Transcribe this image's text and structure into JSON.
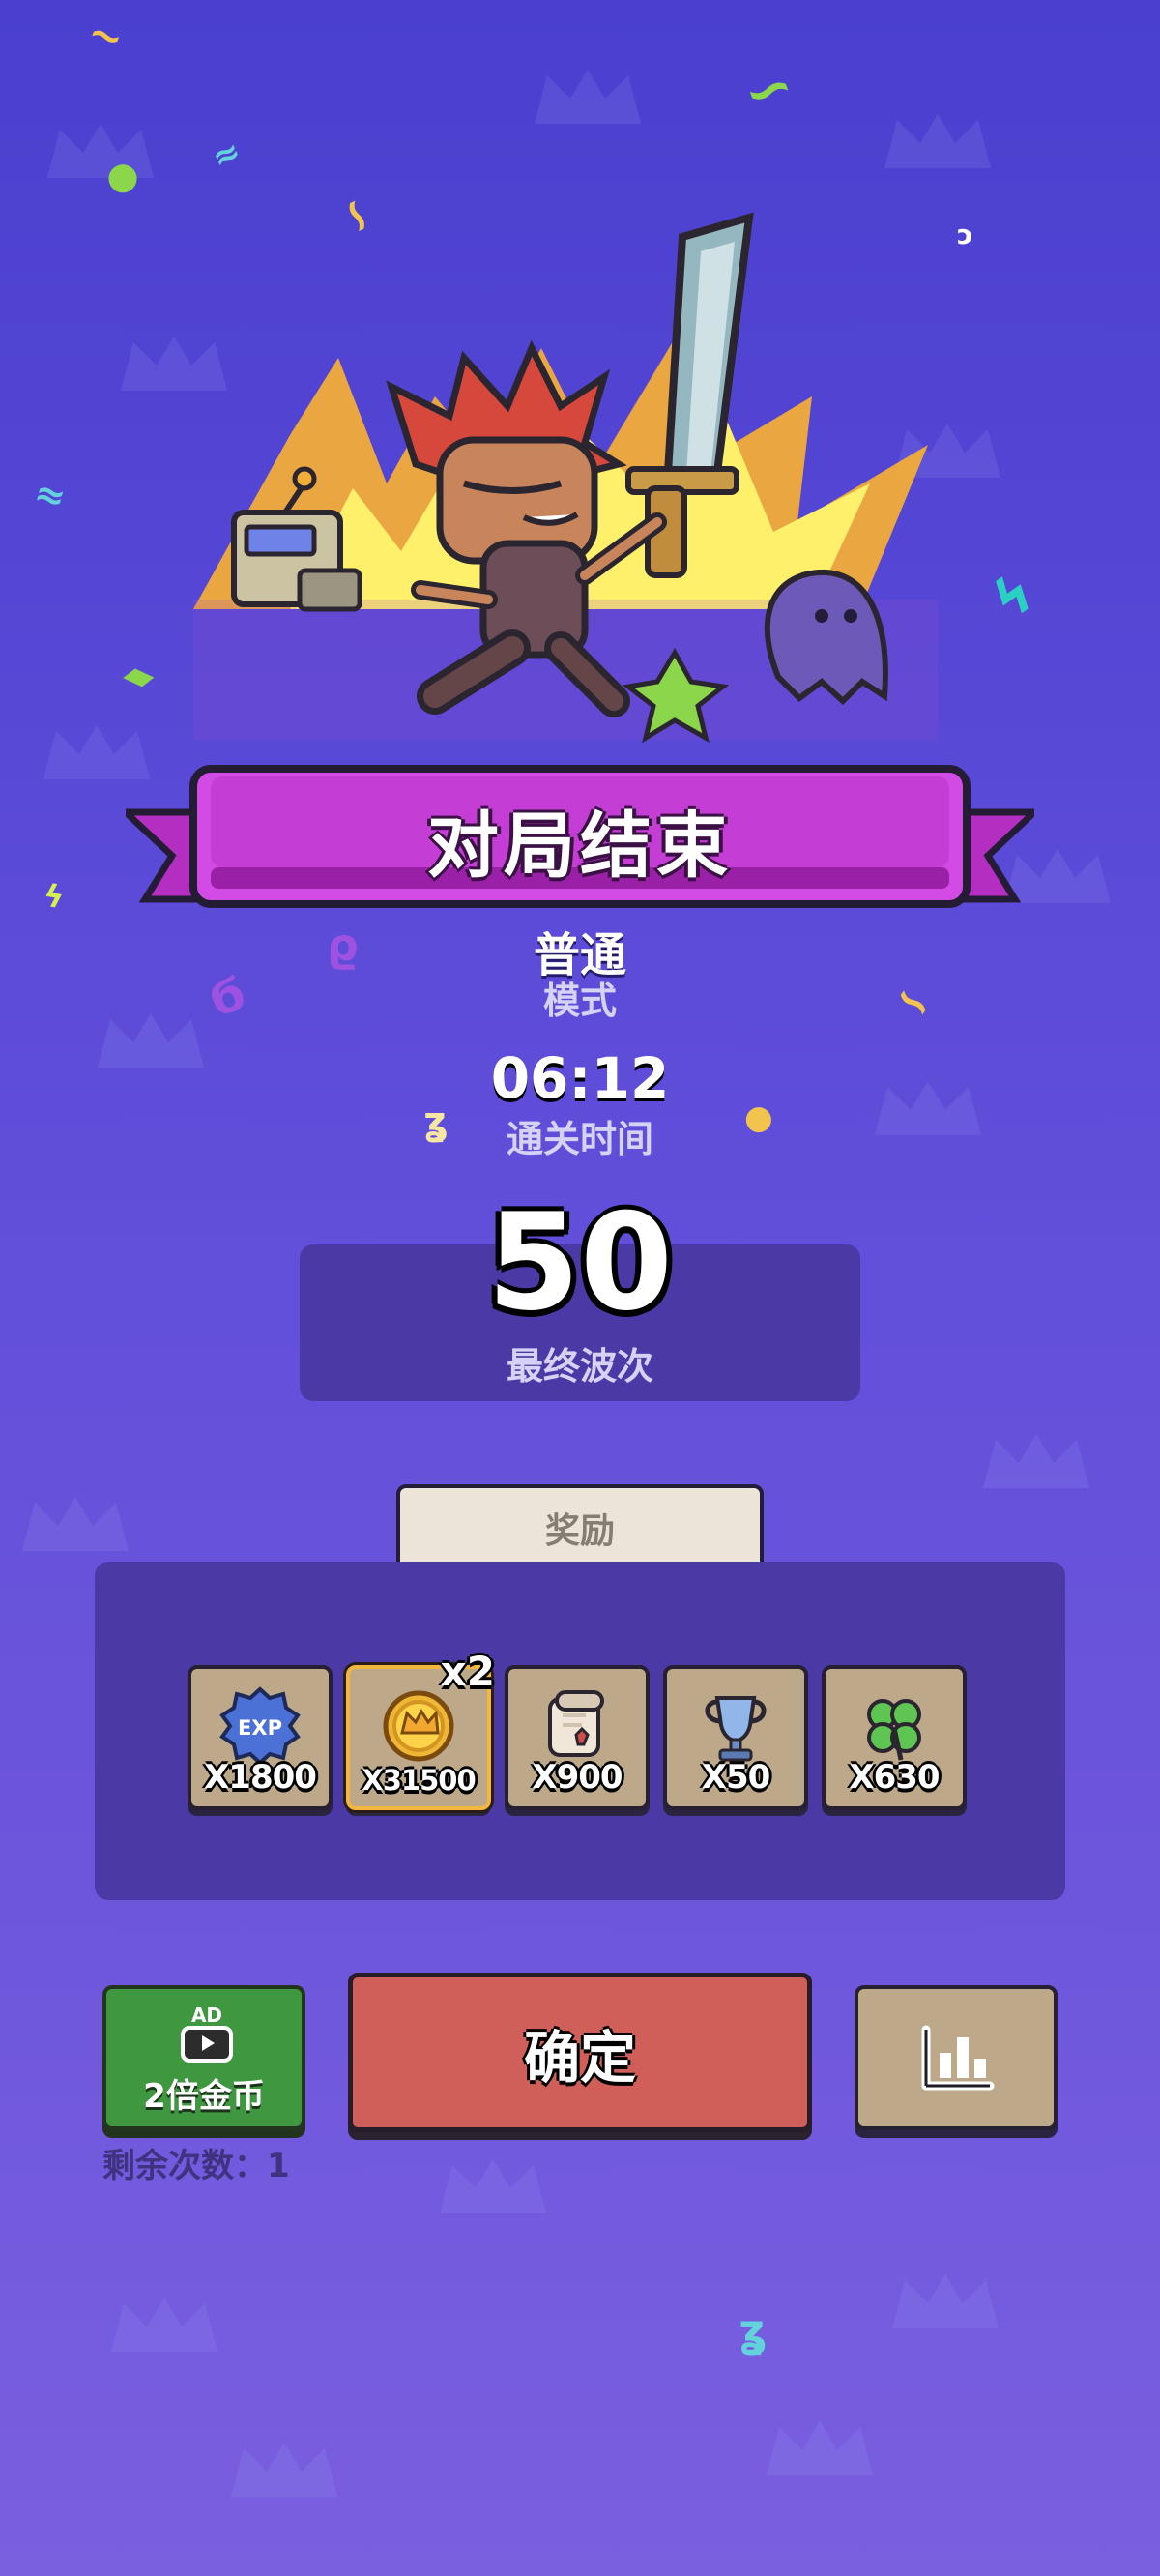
{
  "colors": {
    "background_top": "#4a3fcf",
    "background_bottom": "#7a5fdf",
    "ribbon": "#b531c4",
    "panel": "#4b3aa6",
    "confirm": "#cf5f58",
    "ad_button": "#3f973f",
    "tile": "#bda98a",
    "highlight_border": "#f1b73e"
  },
  "header": {
    "title": "对局结束"
  },
  "summary": {
    "mode_value": "普通",
    "mode_label": "模式",
    "time_value": "06:12",
    "time_label": "通关时间",
    "wave_value": "50",
    "wave_label": "最终波次"
  },
  "rewards": {
    "tab_label": "奖励",
    "items": [
      {
        "icon": "exp-icon",
        "icon_text": "EXP",
        "amount": "X1800"
      },
      {
        "icon": "gold-coin-icon",
        "amount": "X31500",
        "multiplier": "x2"
      },
      {
        "icon": "scroll-icon",
        "amount": "X900"
      },
      {
        "icon": "trophy-icon",
        "amount": "X50"
      },
      {
        "icon": "clover-icon",
        "amount": "X630"
      }
    ]
  },
  "actions": {
    "ad_badge": "AD",
    "ad_label": "2倍金币",
    "ad_remaining": "剩余次数：1",
    "confirm_label": "确定",
    "stats_icon": "bar-chart-icon"
  }
}
